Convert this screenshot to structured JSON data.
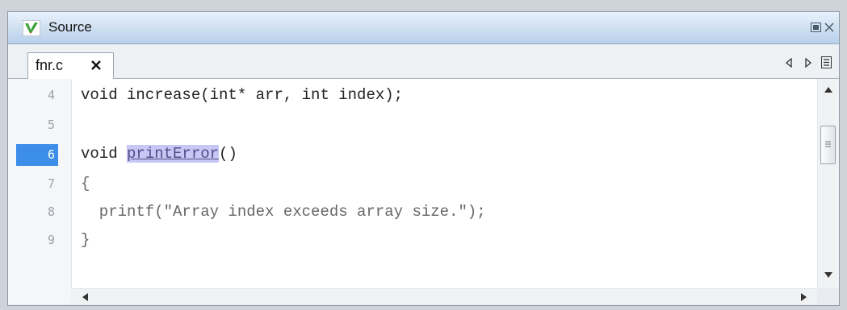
{
  "panel": {
    "title": "Source"
  },
  "tab": {
    "label": "fnr.c"
  },
  "editor": {
    "lines": [
      {
        "number": "4",
        "code": "void increase(int* arr, int index);"
      },
      {
        "number": "5",
        "code": ""
      },
      {
        "number": "6",
        "code_before": "void ",
        "code_highlight": "printError",
        "code_after": "()",
        "current": true
      },
      {
        "number": "7",
        "code": "{"
      },
      {
        "number": "8",
        "code": "  printf(\"Array index exceeds array size.\");"
      },
      {
        "number": "9",
        "code": "}"
      }
    ]
  },
  "colors": {
    "titlebar": "#b7d0ea",
    "current_line_marker": "#3c8ee8",
    "highlight": "#c8c6f4"
  },
  "icons": [
    "app-logo-icon",
    "undock-icon",
    "close-icon",
    "tab-close-icon",
    "previous-icon",
    "next-icon",
    "menu-icon",
    "scroll-up-icon",
    "scroll-down-icon",
    "scroll-left-icon",
    "scroll-right-icon"
  ]
}
